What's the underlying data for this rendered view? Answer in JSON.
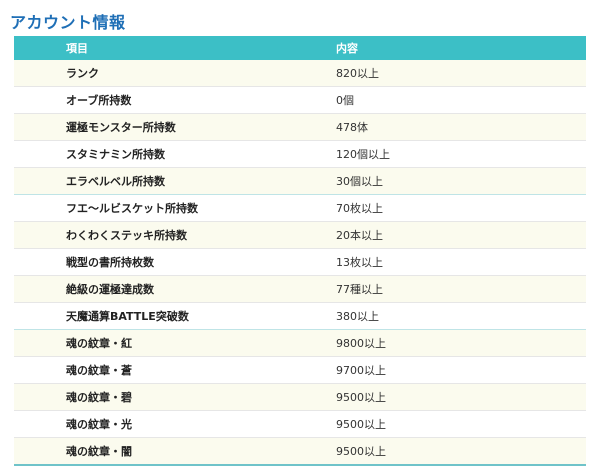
{
  "page": {
    "title": "アカウント情報"
  },
  "table": {
    "headers": [
      "項目",
      "内容"
    ],
    "rows": [
      {
        "item": "ランク",
        "value": "820以上"
      },
      {
        "item": "オーブ所持数",
        "value": "0個"
      },
      {
        "item": "運極モンスター所持数",
        "value": "478体"
      },
      {
        "item": "スタミナミン所持数",
        "value": "120個以上"
      },
      {
        "item": "エラベルベル所持数",
        "value": "30個以上"
      },
      {
        "item": "フエ〜ルビスケット所持数",
        "value": "70枚以上"
      },
      {
        "item": "わくわくステッキ所持数",
        "value": "20本以上"
      },
      {
        "item": "戦型の書所持枚数",
        "value": "13枚以上"
      },
      {
        "item": "絶級の運極達成数",
        "value": "77種以上"
      },
      {
        "item": "天魔通算BATTLE突破数",
        "value": "380以上"
      },
      {
        "item": "魂の紋章・紅",
        "value": "9800以上"
      },
      {
        "item": "魂の紋章・蒼",
        "value": "9700以上"
      },
      {
        "item": "魂の紋章・碧",
        "value": "9500以上"
      },
      {
        "item": "魂の紋章・光",
        "value": "9500以上"
      },
      {
        "item": "魂の紋章・闇",
        "value": "9500以上"
      }
    ]
  }
}
